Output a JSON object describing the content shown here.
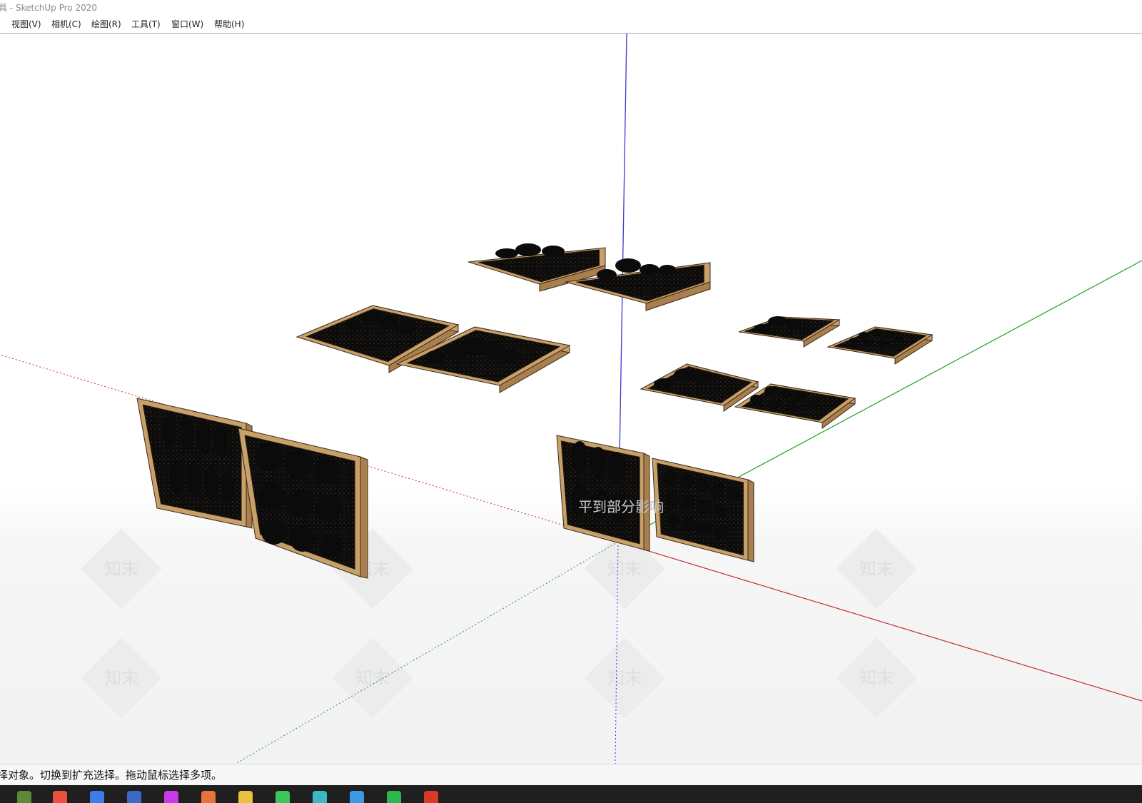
{
  "window": {
    "title": "具 - SketchUp Pro 2020"
  },
  "menu": {
    "items": [
      {
        "label": "视图(V)"
      },
      {
        "label": "相机(C)"
      },
      {
        "label": "绘图(R)"
      },
      {
        "label": "工具(T)"
      },
      {
        "label": "窗口(W)"
      },
      {
        "label": "帮助(H)"
      }
    ]
  },
  "viewport": {
    "watermark_text": "知末",
    "overlay_text": "平到部分影响",
    "axis_colors": {
      "blue": "#3a3ad0",
      "green": "#22a022",
      "red": "#c03030"
    },
    "wood_color": "#c8a06a",
    "wood_dark": "#a87f4d",
    "fruit_color": "#0b0b0b"
  },
  "status": {
    "text": "择对象。切换到扩充选择。拖动鼠标选择多项。"
  },
  "taskbar": {
    "icons": [
      {
        "name": "minecraft-icon",
        "color": "#5c8a3a"
      },
      {
        "name": "media-player-icon",
        "color": "#e8533a"
      },
      {
        "name": "browser-icon",
        "color": "#3a7ee8"
      },
      {
        "name": "file-app-icon",
        "color": "#3a6ac8"
      },
      {
        "name": "colorful-app-icon",
        "color": "#c83ae8"
      },
      {
        "name": "pdf-icon",
        "color": "#e8733a"
      },
      {
        "name": "folder-icon",
        "color": "#e8c23a"
      },
      {
        "name": "wechat-icon",
        "color": "#3ac85a"
      },
      {
        "name": "3d-app-icon",
        "color": "#3ab8c8"
      },
      {
        "name": "edge-icon",
        "color": "#3a9ae8"
      },
      {
        "name": "s-app-icon",
        "color": "#2ab84a"
      },
      {
        "name": "sketchup-icon",
        "color": "#d8392b"
      }
    ]
  }
}
